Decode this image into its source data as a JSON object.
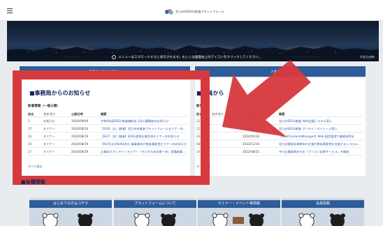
{
  "header": {
    "menu_icon": "hamburger-icon",
    "logo_text": "北九州市SDGs推進プラットフォーム"
  },
  "banner": {
    "note": "メニューはスクロールすると表示されます。もしくは画面右上のアイコンをクリックしてください。",
    "credit": "©北九州市"
  },
  "tabs": {
    "left": "事務局からのお知らせ",
    "right": "入会申し込み"
  },
  "news": {
    "title": "■事務局からのお知らせ",
    "subtitle": "新着情報（一般公開）",
    "columns": [
      "総合",
      "カテゴリ",
      "公開日時",
      "概要"
    ],
    "rows": [
      [
        "2",
        "お知らせ",
        "2024/09/09",
        "令和6年度SDGs推進補助金 2次公募開始のお知らせ"
      ],
      [
        "25",
        "セミナー",
        "2024/08/19",
        "【9/30（火）開催】北九州市推進プラットフォームセミナーのお知らせ"
      ],
      [
        "23",
        "セミナー",
        "2024/08/19",
        "【9/27（金）開催】SDGs実践企業交流セミナーのお知らせ"
      ],
      [
        "25",
        "セミナー",
        "2024/08/19",
        "【9/25(水)/9/26(木)】事業者向け脱炭素経営セミナーのお知らせ"
      ],
      [
        "27",
        "セミナー",
        "2024/08/19",
        "企業向けオンラインセミナー「デジタル化の第一歩」受講者募集のご案内"
      ]
    ],
    "more": "すべて表示"
  },
  "members": {
    "title": "■会員から",
    "subtitle": "新着",
    "columns": [
      "総合",
      "カテゴリ",
      "公開日時",
      "概要"
    ],
    "rows": [
      [
        "227",
        "",
        "2024/05/29",
        "北九州SDGs推進 Web会議システム導入"
      ],
      [
        "227",
        "",
        "2024/05/29",
        "北九州SDGs推進 オンラインストレージ導入"
      ],
      [
        "238",
        "",
        "2024/05/16",
        "【NextContentsManager】Web 配信管理で業務効率化"
      ],
      [
        "660",
        "",
        "2022/11/16",
        "北九州環境未来都市の企業が脱炭素経営を支援するシステムについて"
      ],
      [
        "241",
        "",
        "2022/08/31",
        "中小企業振興のため「パソコン診断サービス」を開始"
      ]
    ],
    "more": "すべて表示"
  },
  "section2": {
    "title": "■各種情報",
    "cards": [
      {
        "label": "はじめての方はコチラ"
      },
      {
        "label": "プラットフォームについて"
      },
      {
        "label": "セミナー・イベント等情報"
      },
      {
        "label": "会員情報"
      }
    ]
  },
  "colors": {
    "accent_blue": "#2e5c99",
    "highlight_red": "#d63a3f",
    "heading_navy": "#12285a"
  }
}
